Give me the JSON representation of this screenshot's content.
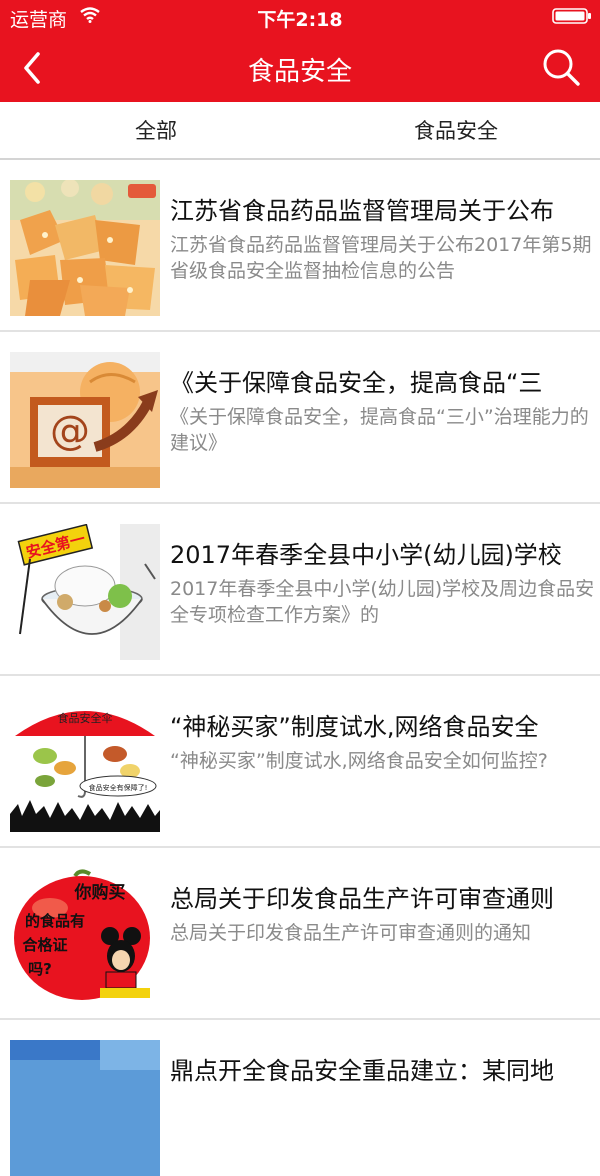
{
  "status": {
    "carrier": "运营商",
    "time": "下午2:18",
    "icons": [
      "wifi-icon",
      "battery-icon"
    ]
  },
  "navbar": {
    "back_icon": "chevron-left-icon",
    "title": "食品安全",
    "search_icon": "search-icon"
  },
  "tabs": [
    {
      "label": "全部"
    },
    {
      "label": "食品安全"
    }
  ],
  "colors": {
    "accent": "#e8131f",
    "summary_text": "#8a8a8a",
    "divider": "#e2e2e2"
  },
  "articles": [
    {
      "title": "江苏省食品药品监督管理局关于公布",
      "summary": "江苏省食品药品监督管理局关于公布2017年第5期省级食品安全监督抽检信息的公告",
      "thumbnail": "dried-fruit-photo"
    },
    {
      "title": "《关于保障食品安全，提高食品“三",
      "summary": "《关于保障食品安全，提高食品“三小”治理能力的建议》",
      "thumbnail": "computer-at-sign-image"
    },
    {
      "title": "2017年春季全县中小学(幼儿园)学校",
      "summary": "2017年春季全县中小学(幼儿园)学校及周边食品安全专项检查工作方案》的",
      "thumbnail": "safety-first-bowl-cartoon",
      "thumb_sign": "安全第一"
    },
    {
      "title": "“神秘买家”制度试水,网络食品安全",
      "summary": "“神秘买家”制度试水,网络食品安全如何监控?",
      "thumbnail": "umbrella-crowd-cartoon",
      "thumb_umbrella": "食品安全伞",
      "thumb_bubble": "食品安全有保障了!"
    },
    {
      "title": "总局关于印发食品生产许可审查通则",
      "summary": "总局关于印发食品生产许可审查通则的通知",
      "thumbnail": "apple-mickey-cartoon",
      "thumb_lines": [
        "你购买",
        "的食品有",
        "合格证",
        "吗?"
      ]
    },
    {
      "title": "鼎点开全食品安全重品建立：某同地",
      "summary": "",
      "thumbnail": "landscape-photo"
    }
  ]
}
